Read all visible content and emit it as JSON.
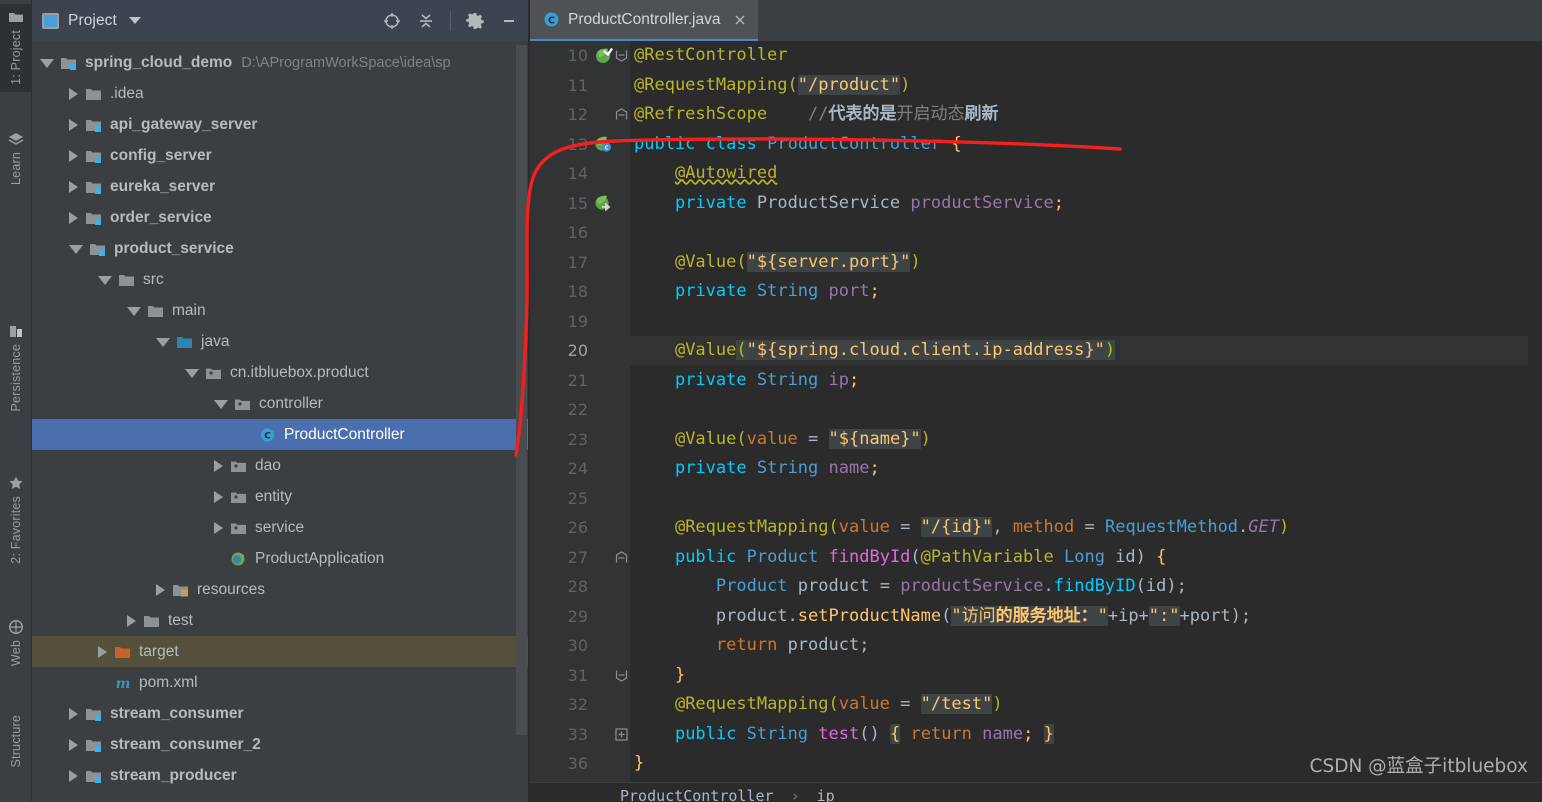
{
  "toolstrip": {
    "items": [
      {
        "label": "1: Project",
        "icon": "folder-icon",
        "active": true
      },
      {
        "label": "Learn",
        "icon": "learn-book-icon",
        "active": false
      },
      {
        "label": "Persistence",
        "icon": "database-icon",
        "active": false
      },
      {
        "label": "2: Favorites",
        "icon": "star-icon",
        "active": false
      },
      {
        "label": "Web",
        "icon": "globe-icon",
        "active": false
      },
      {
        "label": "Structure",
        "icon": "structure-icon",
        "active": false
      }
    ]
  },
  "project_panel": {
    "title": "Project",
    "actions": [
      {
        "name": "select-opened-file-icon",
        "tooltip": "Select Opened File"
      },
      {
        "name": "collapse-all-icon",
        "tooltip": "Collapse All"
      },
      {
        "name": "settings-gear-icon",
        "tooltip": "Settings"
      },
      {
        "name": "hide-icon",
        "tooltip": "Hide"
      }
    ],
    "tree": [
      {
        "label": "spring_cloud_demo",
        "path": "D:\\AProgramWorkSpace\\idea\\sp",
        "depth": 0,
        "state": "open",
        "icon": "module-folder-icon",
        "bold": true,
        "style": "normal"
      },
      {
        "label": ".idea",
        "path": "",
        "depth": 1,
        "state": "closed",
        "icon": "folder-icon",
        "bold": false,
        "style": "normal"
      },
      {
        "label": "api_gateway_server",
        "path": "",
        "depth": 1,
        "state": "closed",
        "icon": "module-folder-icon",
        "bold": true,
        "style": "normal"
      },
      {
        "label": "config_server",
        "path": "",
        "depth": 1,
        "state": "closed",
        "icon": "module-folder-icon",
        "bold": true,
        "style": "normal"
      },
      {
        "label": "eureka_server",
        "path": "",
        "depth": 1,
        "state": "closed",
        "icon": "module-folder-icon",
        "bold": true,
        "style": "normal"
      },
      {
        "label": "order_service",
        "path": "",
        "depth": 1,
        "state": "closed",
        "icon": "module-folder-icon",
        "bold": true,
        "style": "normal"
      },
      {
        "label": "product_service",
        "path": "",
        "depth": 1,
        "state": "open",
        "icon": "module-folder-icon",
        "bold": true,
        "style": "normal"
      },
      {
        "label": "src",
        "path": "",
        "depth": 2,
        "state": "open",
        "icon": "folder-icon",
        "bold": false,
        "style": "normal"
      },
      {
        "label": "main",
        "path": "",
        "depth": 3,
        "state": "open",
        "icon": "folder-icon",
        "bold": false,
        "style": "normal"
      },
      {
        "label": "java",
        "path": "",
        "depth": 4,
        "state": "open",
        "icon": "source-folder-icon",
        "bold": false,
        "style": "normal"
      },
      {
        "label": "cn.itbluebox.product",
        "path": "",
        "depth": 5,
        "state": "open",
        "icon": "package-icon",
        "bold": false,
        "style": "normal"
      },
      {
        "label": "controller",
        "path": "",
        "depth": 6,
        "state": "open",
        "icon": "package-icon",
        "bold": false,
        "style": "normal"
      },
      {
        "label": "ProductController",
        "path": "",
        "depth": 7,
        "state": "leaf",
        "icon": "java-class-icon",
        "bold": false,
        "style": "selected"
      },
      {
        "label": "dao",
        "path": "",
        "depth": 6,
        "state": "closed",
        "icon": "package-icon",
        "bold": false,
        "style": "normal"
      },
      {
        "label": "entity",
        "path": "",
        "depth": 6,
        "state": "closed",
        "icon": "package-icon",
        "bold": false,
        "style": "normal"
      },
      {
        "label": "service",
        "path": "",
        "depth": 6,
        "state": "closed",
        "icon": "package-icon",
        "bold": false,
        "style": "normal"
      },
      {
        "label": "ProductApplication",
        "path": "",
        "depth": 6,
        "state": "leaf",
        "icon": "spring-boot-class-icon",
        "bold": false,
        "style": "normal"
      },
      {
        "label": "resources",
        "path": "",
        "depth": 4,
        "state": "closed",
        "icon": "resources-folder-icon",
        "bold": false,
        "style": "normal"
      },
      {
        "label": "test",
        "path": "",
        "depth": 3,
        "state": "closed",
        "icon": "folder-icon",
        "bold": false,
        "style": "normal"
      },
      {
        "label": "target",
        "path": "",
        "depth": 2,
        "state": "closed",
        "icon": "excluded-folder-icon",
        "bold": false,
        "style": "marked"
      },
      {
        "label": "pom.xml",
        "path": "",
        "depth": 2,
        "state": "leaf",
        "icon": "maven-icon",
        "bold": false,
        "style": "normal"
      },
      {
        "label": "stream_consumer",
        "path": "",
        "depth": 1,
        "state": "closed",
        "icon": "module-folder-icon",
        "bold": true,
        "style": "normal"
      },
      {
        "label": "stream_consumer_2",
        "path": "",
        "depth": 1,
        "state": "closed",
        "icon": "module-folder-icon",
        "bold": true,
        "style": "normal"
      },
      {
        "label": "stream_producer",
        "path": "",
        "depth": 1,
        "state": "closed",
        "icon": "module-folder-icon",
        "bold": true,
        "style": "normal"
      }
    ]
  },
  "editor": {
    "tab": {
      "label": "ProductController.java",
      "icon": "java-class-icon",
      "close": "close-icon"
    },
    "breadcrumb": {
      "class": "ProductController",
      "separator": "›",
      "member": "ip"
    },
    "first_line": 10,
    "lines": [
      {
        "num": 10,
        "gutter": "spring-bean-check-icon",
        "fold": "fold-end-icon"
      },
      {
        "num": 11,
        "gutter": "",
        "fold": ""
      },
      {
        "num": 12,
        "gutter": "",
        "fold": "fold-start-icon"
      },
      {
        "num": 13,
        "gutter": "spring-bean-class-icon",
        "fold": ""
      },
      {
        "num": 14,
        "gutter": "",
        "fold": ""
      },
      {
        "num": 15,
        "gutter": "spring-bean-arrow-icon",
        "fold": ""
      },
      {
        "num": 16,
        "gutter": "",
        "fold": ""
      },
      {
        "num": 17,
        "gutter": "",
        "fold": ""
      },
      {
        "num": 18,
        "gutter": "",
        "fold": ""
      },
      {
        "num": 19,
        "gutter": "",
        "fold": ""
      },
      {
        "num": 20,
        "gutter": "",
        "fold": "",
        "current": true
      },
      {
        "num": 21,
        "gutter": "",
        "fold": ""
      },
      {
        "num": 22,
        "gutter": "",
        "fold": ""
      },
      {
        "num": 23,
        "gutter": "",
        "fold": ""
      },
      {
        "num": 24,
        "gutter": "",
        "fold": ""
      },
      {
        "num": 25,
        "gutter": "",
        "fold": ""
      },
      {
        "num": 26,
        "gutter": "",
        "fold": ""
      },
      {
        "num": 27,
        "gutter": "",
        "fold": "fold-start-icon"
      },
      {
        "num": 28,
        "gutter": "",
        "fold": ""
      },
      {
        "num": 29,
        "gutter": "",
        "fold": ""
      },
      {
        "num": 30,
        "gutter": "",
        "fold": ""
      },
      {
        "num": 31,
        "gutter": "",
        "fold": "fold-end-icon"
      },
      {
        "num": 32,
        "gutter": "",
        "fold": ""
      },
      {
        "num": 33,
        "gutter": "",
        "fold": "fold-collapsed-icon"
      },
      {
        "num": 36,
        "gutter": "",
        "fold": ""
      }
    ],
    "source_text": [
      "@RestController",
      "@RequestMapping(\"/product\")",
      "@RefreshScope    //代表的是开启动态刷新",
      "public class ProductController {",
      "    @Autowired",
      "    private ProductService productService;",
      "",
      "    @Value(\"${server.port}\")",
      "    private String port;",
      "",
      "    @Value(\"${spring.cloud.client.ip-address}\")",
      "    private String ip;",
      "",
      "    @Value(value = \"${name}\")",
      "    private String name;",
      "",
      "    @RequestMapping(value = \"/{id}\", method = RequestMethod.GET)",
      "    public Product findById(@PathVariable Long id) {",
      "        Product product = productService.findByID(id);",
      "        product.setProductName(\"访问的服务地址：\"+ip+\":\"+port);",
      "        return product;",
      "    }",
      "    @RequestMapping(value = \"/test\")",
      "    public String test() { return name; }",
      "}"
    ]
  },
  "watermark": "CSDN @蓝盒子itbluebox",
  "colors": {
    "editor_bg": "#2b2b2b",
    "gutter_bg": "#313335",
    "panel_bg": "#3c3f41",
    "panel_header_bg": "#3c4450",
    "selection_blue": "#4b6eaf",
    "marked_olive": "#55503c",
    "annotation_red": "#f41f1f",
    "tab_underline": "#4a88c7"
  }
}
